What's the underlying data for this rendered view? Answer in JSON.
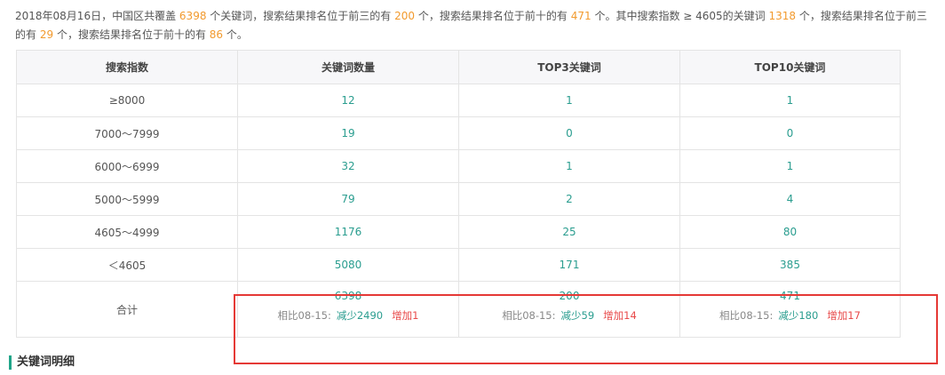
{
  "summary": {
    "p1": "2018年08月16日，中国区共覆盖",
    "n1": "6398",
    "p2": "个关键词，搜索结果排名位于前三的有",
    "n2": "200",
    "p3": "个，搜索结果排名位于前十的有",
    "n3": "471",
    "p4": "个。其中搜索指数 ≥ 4605的关键词",
    "n4": "1318",
    "p5": "个，搜索结果排名位于前三的有",
    "n5": "29",
    "p6": "个，搜索结果排名位于前十的有",
    "n6": "86",
    "p7": "个。"
  },
  "table": {
    "headers": [
      "搜索指数",
      "关键词数量",
      "TOP3关键词",
      "TOP10关键词"
    ],
    "rows": [
      [
        "≥8000",
        "12",
        "1",
        "1"
      ],
      [
        "7000～7999",
        "19",
        "0",
        "0"
      ],
      [
        "6000～6999",
        "32",
        "1",
        "1"
      ],
      [
        "5000～5999",
        "79",
        "2",
        "4"
      ],
      [
        "4605～4999",
        "1176",
        "25",
        "80"
      ],
      [
        "＜4605",
        "5080",
        "171",
        "385"
      ]
    ],
    "total": {
      "label": "合计",
      "cells": [
        {
          "value": "6398",
          "compare_label": "相比08-15:",
          "down": "减少2490",
          "up": "增加1"
        },
        {
          "value": "200",
          "compare_label": "相比08-15:",
          "down": "减少59",
          "up": "增加14"
        },
        {
          "value": "471",
          "compare_label": "相比08-15:",
          "down": "减少180",
          "up": "增加17"
        }
      ]
    }
  },
  "section": {
    "title": "关键词明细"
  },
  "colors": {
    "accent": "#2a9d8f",
    "highlight": "#f29a2e",
    "increase": "#e84a4a",
    "annotation_box": "#e53935"
  }
}
